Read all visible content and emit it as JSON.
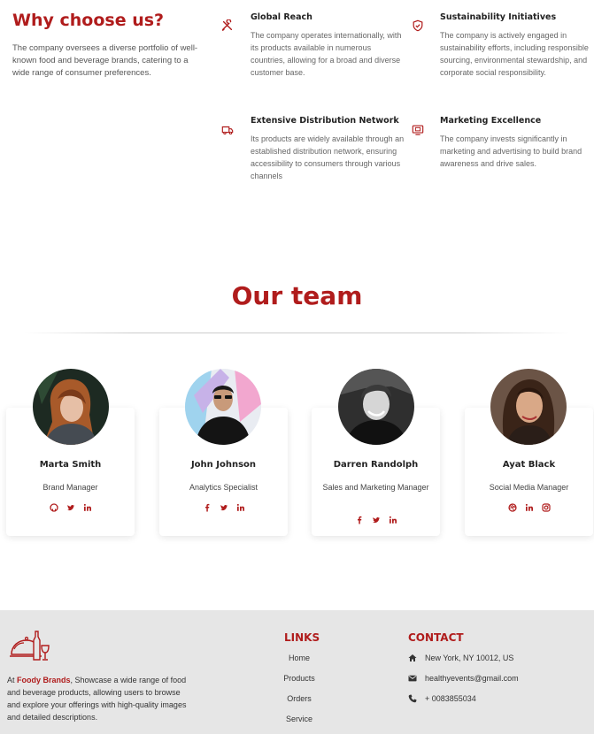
{
  "why": {
    "title": "Why choose us?",
    "description": "The company oversees a diverse portfolio of well-known food and beverage brands, catering to a wide range of consumer preferences."
  },
  "features": [
    {
      "title": "Global Reach",
      "text": "The company operates internationally, with its products available in numerous countries, allowing for a broad and diverse customer base.",
      "icon": "tools-icon"
    },
    {
      "title": "Sustainability Initiatives",
      "text": "The company is actively engaged in sustainability efforts, including responsible sourcing, environmental stewardship, and corporate social responsibility.",
      "icon": "shield-check-icon"
    },
    {
      "title": "Extensive Distribution Network",
      "text": "Its products are widely available through an established distribution network, ensuring accessibility to consumers through various channels",
      "icon": "truck-icon"
    },
    {
      "title": "Marketing Excellence",
      "text": "The company invests significantly in marketing and advertising to build brand awareness and drive sales.",
      "icon": "monitor-icon"
    }
  ],
  "team": {
    "title": "Our team",
    "members": [
      {
        "name": "Marta Smith",
        "role": "Brand Manager",
        "socials": [
          "github-icon",
          "twitter-icon",
          "linkedin-icon"
        ]
      },
      {
        "name": "John Johnson",
        "role": "Analytics Specialist",
        "socials": [
          "facebook-icon",
          "twitter-icon",
          "linkedin-icon"
        ]
      },
      {
        "name": "Darren Randolph",
        "role": "Sales and Marketing Manager",
        "socials": [
          "facebook-icon",
          "twitter-icon",
          "linkedin-icon"
        ]
      },
      {
        "name": "Ayat Black",
        "role": "Social Media Manager",
        "socials": [
          "dribbble-icon",
          "linkedin-icon",
          "instagram-icon"
        ]
      }
    ]
  },
  "footer": {
    "brand_prefix": "At ",
    "brand": "Foody Brands",
    "brand_suffix": ", Showcase a wide range of food and beverage products, allowing users to browse and explore your offerings with high-quality images and detailed descriptions.",
    "links_title": "LINKS",
    "links": [
      "Home",
      "Products",
      "Orders",
      "Service"
    ],
    "contact_title": "CONTACT",
    "address": "New York, NY 10012, US",
    "email": "healthyevents@gmail.com",
    "phone": "+ 0083855034"
  },
  "colors": {
    "accent": "#b01c1c",
    "footer_bg": "#e6e6e6"
  }
}
